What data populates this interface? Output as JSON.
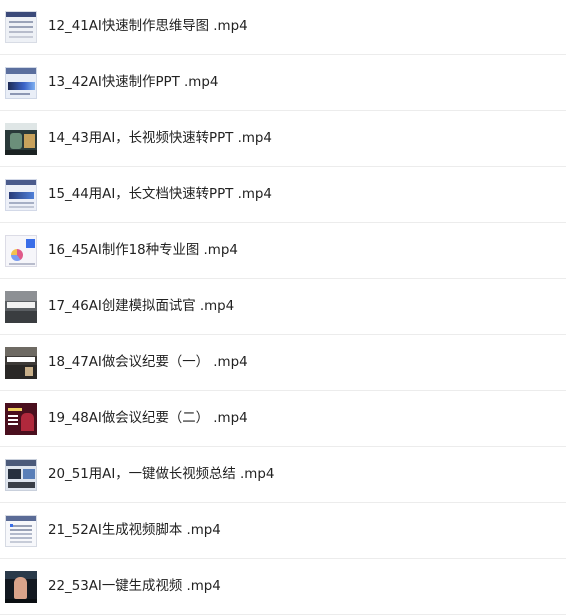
{
  "files": [
    {
      "name": "12_41AI快速制作思维导图 .mp4",
      "thumb_style": "light"
    },
    {
      "name": "13_42AI快速制作PPT .mp4",
      "thumb_style": "blue"
    },
    {
      "name": "14_43用AI，长视频快速转PPT .mp4",
      "thumb_style": "video"
    },
    {
      "name": "15_44用AI，长文档快速转PPT .mp4",
      "thumb_style": "doc"
    },
    {
      "name": "16_45AI制作18种专业图 .mp4",
      "thumb_style": "chart"
    },
    {
      "name": "17_46AI创建模拟面试官 .mp4",
      "thumb_style": "dark"
    },
    {
      "name": "18_47AI做会议纪要（一） .mp4",
      "thumb_style": "meeting"
    },
    {
      "name": "19_48AI做会议纪要（二） .mp4",
      "thumb_style": "red"
    },
    {
      "name": "20_51用AI，一键做长视频总结 .mp4",
      "thumb_style": "mix"
    },
    {
      "name": "21_52AI生成视频脚本 .mp4",
      "thumb_style": "form"
    },
    {
      "name": "22_53AI一键生成视频 .mp4",
      "thumb_style": "night"
    }
  ]
}
